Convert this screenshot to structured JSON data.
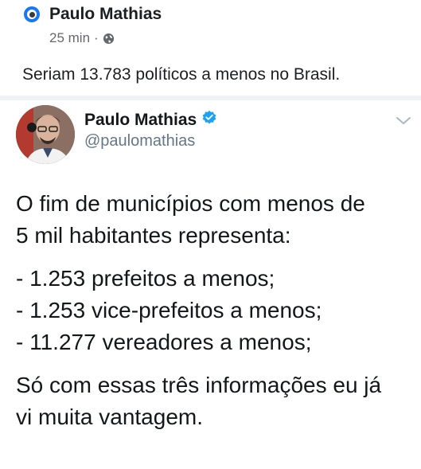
{
  "facebook_post": {
    "author": "Paulo Mathias",
    "time": "25 min",
    "separator": "·",
    "privacy_icon": "globe-icon",
    "text": "Seriam 13.783 políticos a menos no Brasil."
  },
  "tweet": {
    "name": "Paulo Mathias",
    "verified_icon": "verified-badge-icon",
    "handle": "@paulomathias",
    "menu_icon": "chevron-down-icon",
    "lines": {
      "l1": "O fim de municípios com menos de",
      "l2": "5 mil habitantes representa:",
      "l3": "- 1.253 prefeitos a menos;",
      "l4": "- 1.253 vice-prefeitos a menos;",
      "l5": "- 11.277 vereadores a menos;",
      "l6": "Só com essas três informações eu já",
      "l7": "vi muita vantagem."
    }
  },
  "colors": {
    "facebook_blue": "#1877f2",
    "twitter_blue": "#1da1f2",
    "secondary_text": "#65676b"
  }
}
